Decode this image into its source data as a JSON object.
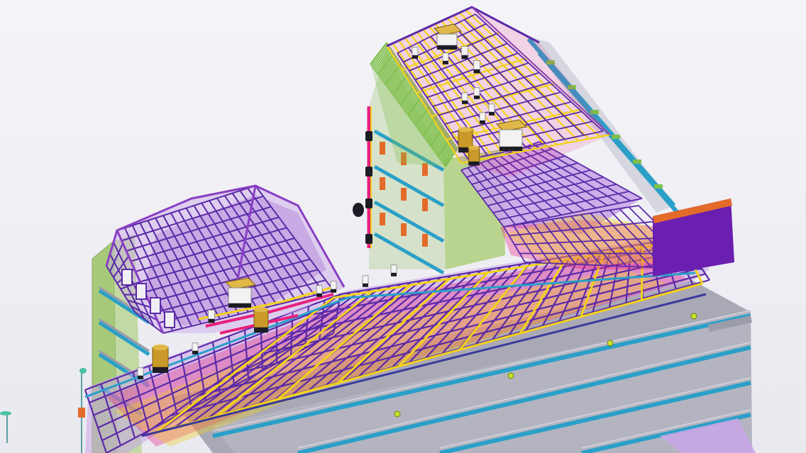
{
  "scene": {
    "kind": "3d-bim-model",
    "background": "#eeeef3",
    "palette": {
      "wall_green": "#a7c97a",
      "slab_grey": "#a9a9b6",
      "slab_edge_blue": "#2aa0c8",
      "frame_purple": "#5b2aa8",
      "frame_violet": "#8a3fc4",
      "beam_yellow": "#f2d21a",
      "duct_magenta": "#e8207e",
      "duct_orange": "#e46a2a",
      "panel_lilac": "#c9a6e8",
      "tank_gold": "#c99a2a",
      "vent_white": "#f2f2f2",
      "dark": "#1c1c24",
      "roof_green": "#7fbf4a"
    }
  }
}
